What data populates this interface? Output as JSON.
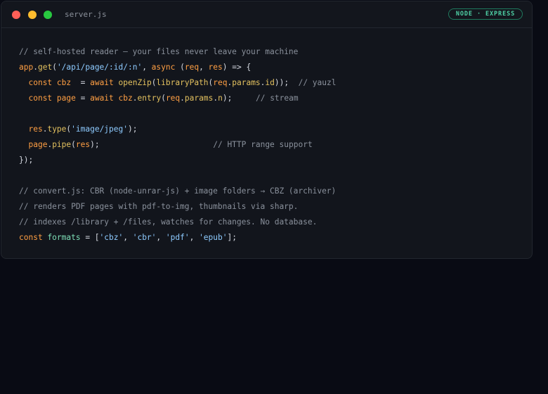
{
  "window": {
    "filename": "server.js",
    "badge": "NODE · EXPRESS"
  },
  "code": {
    "lines": [
      [
        {
          "t": "// self-hosted reader — your files never leave your machine",
          "c": "comment"
        }
      ],
      [
        {
          "t": "app",
          "c": "var"
        },
        {
          "t": ".",
          "c": "plain"
        },
        {
          "t": "get",
          "c": "fn"
        },
        {
          "t": "(",
          "c": "plain"
        },
        {
          "t": "'/api/page/:id/:n'",
          "c": "str"
        },
        {
          "t": ", ",
          "c": "plain"
        },
        {
          "t": "async",
          "c": "kw"
        },
        {
          "t": " (",
          "c": "plain"
        },
        {
          "t": "req",
          "c": "var"
        },
        {
          "t": ", ",
          "c": "plain"
        },
        {
          "t": "res",
          "c": "var"
        },
        {
          "t": ") => {",
          "c": "plain"
        }
      ],
      [
        {
          "t": "  ",
          "c": "plain"
        },
        {
          "t": "const",
          "c": "kw"
        },
        {
          "t": " ",
          "c": "plain"
        },
        {
          "t": "cbz",
          "c": "var"
        },
        {
          "t": "  = ",
          "c": "plain"
        },
        {
          "t": "await",
          "c": "kw"
        },
        {
          "t": " ",
          "c": "plain"
        },
        {
          "t": "openZip",
          "c": "fn"
        },
        {
          "t": "(",
          "c": "plain"
        },
        {
          "t": "libraryPath",
          "c": "fn"
        },
        {
          "t": "(",
          "c": "plain"
        },
        {
          "t": "req",
          "c": "var"
        },
        {
          "t": ".",
          "c": "plain"
        },
        {
          "t": "params",
          "c": "prop"
        },
        {
          "t": ".",
          "c": "plain"
        },
        {
          "t": "id",
          "c": "prop"
        },
        {
          "t": "));  ",
          "c": "plain"
        },
        {
          "t": "// yauzl",
          "c": "comment"
        }
      ],
      [
        {
          "t": "  ",
          "c": "plain"
        },
        {
          "t": "const",
          "c": "kw"
        },
        {
          "t": " ",
          "c": "plain"
        },
        {
          "t": "page",
          "c": "var"
        },
        {
          "t": " = ",
          "c": "plain"
        },
        {
          "t": "await",
          "c": "kw"
        },
        {
          "t": " ",
          "c": "plain"
        },
        {
          "t": "cbz",
          "c": "var"
        },
        {
          "t": ".",
          "c": "plain"
        },
        {
          "t": "entry",
          "c": "fn"
        },
        {
          "t": "(",
          "c": "plain"
        },
        {
          "t": "req",
          "c": "var"
        },
        {
          "t": ".",
          "c": "plain"
        },
        {
          "t": "params",
          "c": "prop"
        },
        {
          "t": ".",
          "c": "plain"
        },
        {
          "t": "n",
          "c": "prop"
        },
        {
          "t": ");     ",
          "c": "plain"
        },
        {
          "t": "// stream",
          "c": "comment"
        }
      ],
      [
        {
          "t": "",
          "c": "plain"
        }
      ],
      [
        {
          "t": "  ",
          "c": "plain"
        },
        {
          "t": "res",
          "c": "var"
        },
        {
          "t": ".",
          "c": "plain"
        },
        {
          "t": "type",
          "c": "fn"
        },
        {
          "t": "(",
          "c": "plain"
        },
        {
          "t": "'image/jpeg'",
          "c": "str"
        },
        {
          "t": ");",
          "c": "plain"
        }
      ],
      [
        {
          "t": "  ",
          "c": "plain"
        },
        {
          "t": "page",
          "c": "var"
        },
        {
          "t": ".",
          "c": "plain"
        },
        {
          "t": "pipe",
          "c": "fn"
        },
        {
          "t": "(",
          "c": "plain"
        },
        {
          "t": "res",
          "c": "var"
        },
        {
          "t": ");                        ",
          "c": "plain"
        },
        {
          "t": "// HTTP range support",
          "c": "comment"
        }
      ],
      [
        {
          "t": "});",
          "c": "plain"
        }
      ],
      [
        {
          "t": "",
          "c": "plain"
        }
      ],
      [
        {
          "t": "// convert.js: CBR (node-unrar-js) + image folders → CBZ (archiver)",
          "c": "comment"
        }
      ],
      [
        {
          "t": "// renders PDF pages with pdf-to-img, thumbnails via sharp.",
          "c": "comment"
        }
      ],
      [
        {
          "t": "// indexes /library + /files, watches for changes. No database.",
          "c": "comment"
        }
      ],
      [
        {
          "t": "const",
          "c": "kw"
        },
        {
          "t": " ",
          "c": "plain"
        },
        {
          "t": "formats",
          "c": "ident"
        },
        {
          "t": " = [",
          "c": "plain"
        },
        {
          "t": "'cbz'",
          "c": "str"
        },
        {
          "t": ", ",
          "c": "plain"
        },
        {
          "t": "'cbr'",
          "c": "str"
        },
        {
          "t": ", ",
          "c": "plain"
        },
        {
          "t": "'pdf'",
          "c": "str"
        },
        {
          "t": ", ",
          "c": "plain"
        },
        {
          "t": "'epub'",
          "c": "str"
        },
        {
          "t": "];",
          "c": "plain"
        }
      ]
    ]
  },
  "colors": {
    "background": "#090b14",
    "window": "#12151c",
    "keyword": "#ff9f43",
    "string": "#8ecbff",
    "function": "#e3c15f",
    "comment": "#8a919c",
    "badge": "#4fd1a6"
  }
}
